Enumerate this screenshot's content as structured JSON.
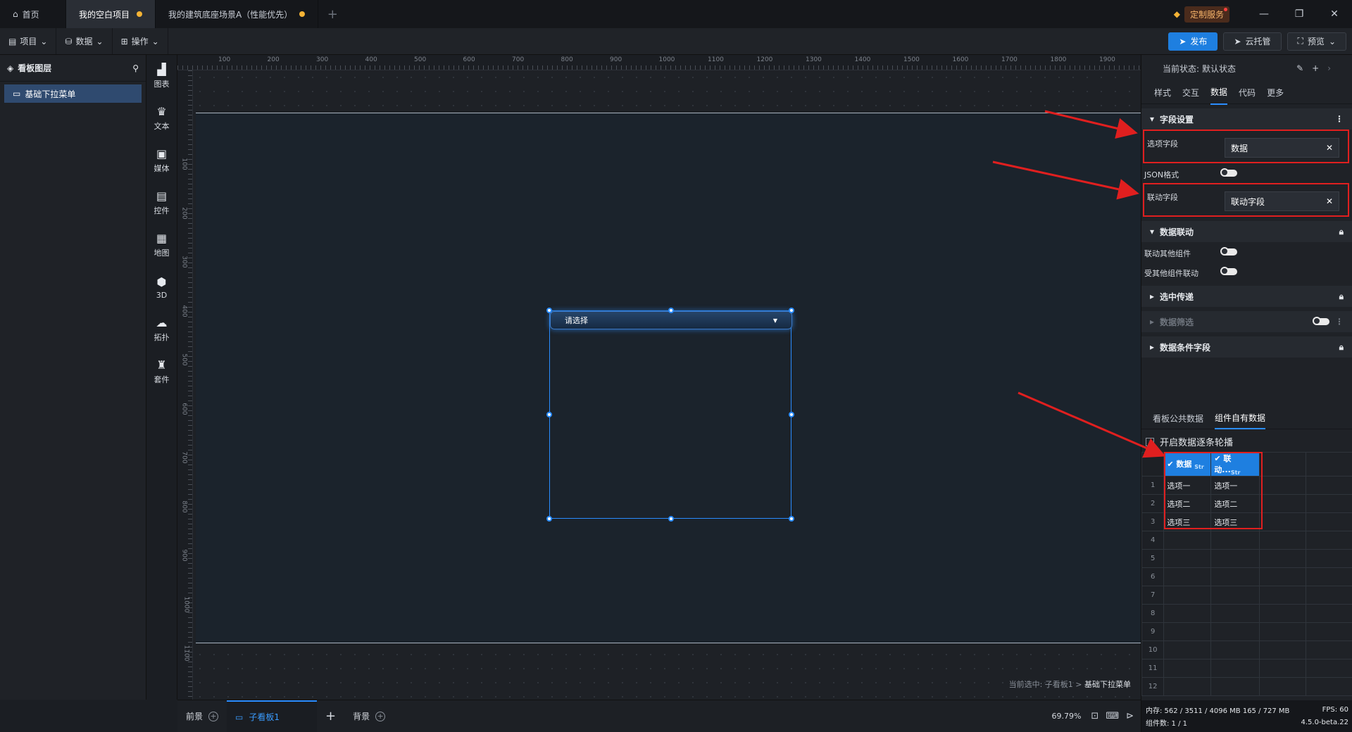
{
  "titlebar": {
    "tabs": [
      {
        "label": "首页"
      },
      {
        "label": "我的空白项目"
      },
      {
        "label": "我的建筑底座场景A（性能优先）"
      }
    ],
    "service_label": "定制服务"
  },
  "toolbar": {
    "menus": [
      "项目",
      "数据",
      "操作"
    ],
    "publish": "发布",
    "cloud": "云托管",
    "preview": "预览"
  },
  "layers": {
    "title": "看板图层",
    "items": [
      "基础下拉菜单"
    ]
  },
  "rail": [
    "图表",
    "文本",
    "媒体",
    "控件",
    "地图",
    "3D",
    "拓扑",
    "套件"
  ],
  "ruler": {
    "top": [
      "100",
      "200",
      "300",
      "400",
      "500",
      "600",
      "700",
      "800",
      "900",
      "1000",
      "1100",
      "1200",
      "1300",
      "1400",
      "1500",
      "1600",
      "1700",
      "1800",
      "1900"
    ],
    "left": [
      "100",
      "200",
      "300",
      "400",
      "500",
      "600",
      "700",
      "800",
      "900",
      "1000",
      "1100"
    ]
  },
  "canvas": {
    "dropdown_placeholder": "请选择",
    "current_selection_prefix": "当前选中: 子看板1 > ",
    "current_selection_item": "基础下拉菜单"
  },
  "bottombar": {
    "tabs": [
      "前景",
      "子看板1",
      "背景"
    ],
    "zoom": "69.79%"
  },
  "rightpanel": {
    "state_label": "当前状态:",
    "state_value": "默认状态",
    "tabs": [
      "样式",
      "交互",
      "数据",
      "代码",
      "更多"
    ],
    "field_settings": "字段设置",
    "option_field_label": "选项字段",
    "option_field_value": "数据",
    "json_label": "JSON格式",
    "link_field_label": "联动字段",
    "link_field_value": "联动字段",
    "data_link": "数据联动",
    "link_other": "联动其他组件",
    "be_linked": "受其他组件联动",
    "select_pass": "选中传递",
    "data_filter": "数据筛选",
    "data_condition": "数据条件字段",
    "data_tabs": [
      "看板公共数据",
      "组件自有数据"
    ],
    "carousel": "开启数据逐条轮播",
    "grid": {
      "headers": [
        {
          "label": "数据",
          "type": "Str"
        },
        {
          "label": "联动...",
          "type": "Str"
        }
      ],
      "rows": [
        [
          "选项一",
          "选项一"
        ],
        [
          "选项二",
          "选项二"
        ],
        [
          "选项三",
          "选项三"
        ]
      ],
      "row_numbers": [
        "1",
        "2",
        "3",
        "4",
        "5",
        "6",
        "7",
        "8",
        "9",
        "10",
        "11",
        "12"
      ]
    },
    "status": {
      "memory": "内存: 562 / 3511 / 4096 MB 165 / 727 MB",
      "fps": "FPS: 60",
      "components": "组件数: 1 / 1",
      "version": "4.5.0-beta.22"
    }
  },
  "colors": {
    "accent": "#1e7fe0",
    "annotation": "#e01f1f",
    "unsaved_dot": "#f5b335"
  }
}
